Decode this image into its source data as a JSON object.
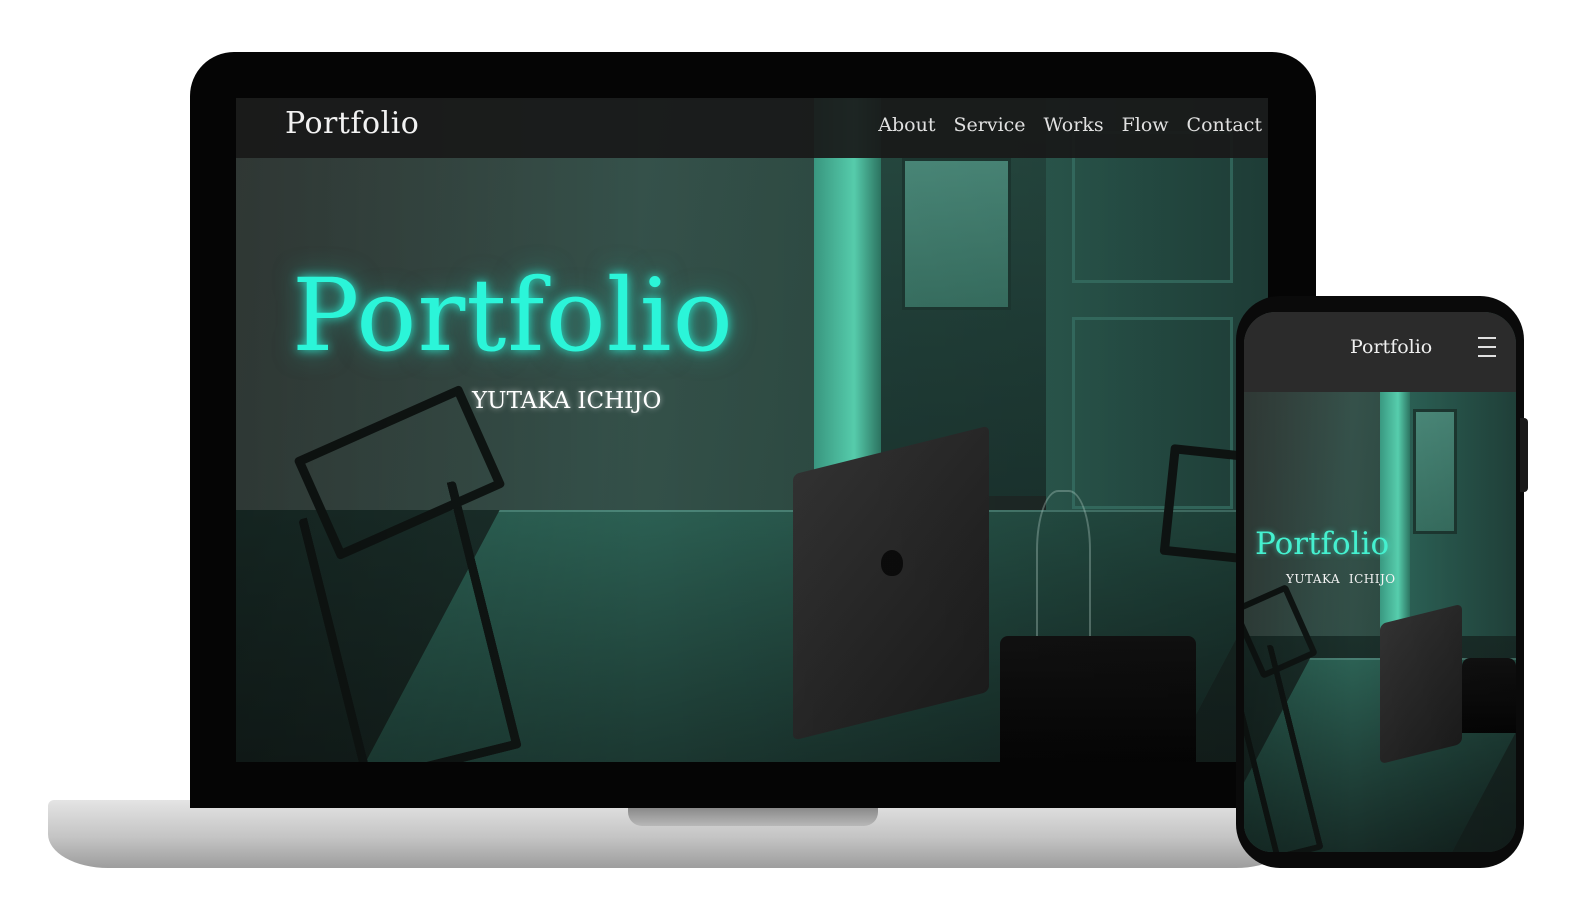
{
  "desktop": {
    "site_logo": "Portfolio",
    "nav": [
      "About",
      "Service",
      "Works",
      "Flow",
      "Contact"
    ],
    "hero_title": "Portfolio",
    "hero_subtitle": "YUTAKA ICHIJO"
  },
  "mobile": {
    "site_logo": "Portfolio",
    "menu_icon": "hamburger-icon",
    "hero_title": "Portfolio",
    "hero_subtitle": "YUTAKA  ICHIJO"
  },
  "colors": {
    "accent": "#2bf5d9",
    "header_bg": "#191919",
    "device_frame": "#050505"
  }
}
